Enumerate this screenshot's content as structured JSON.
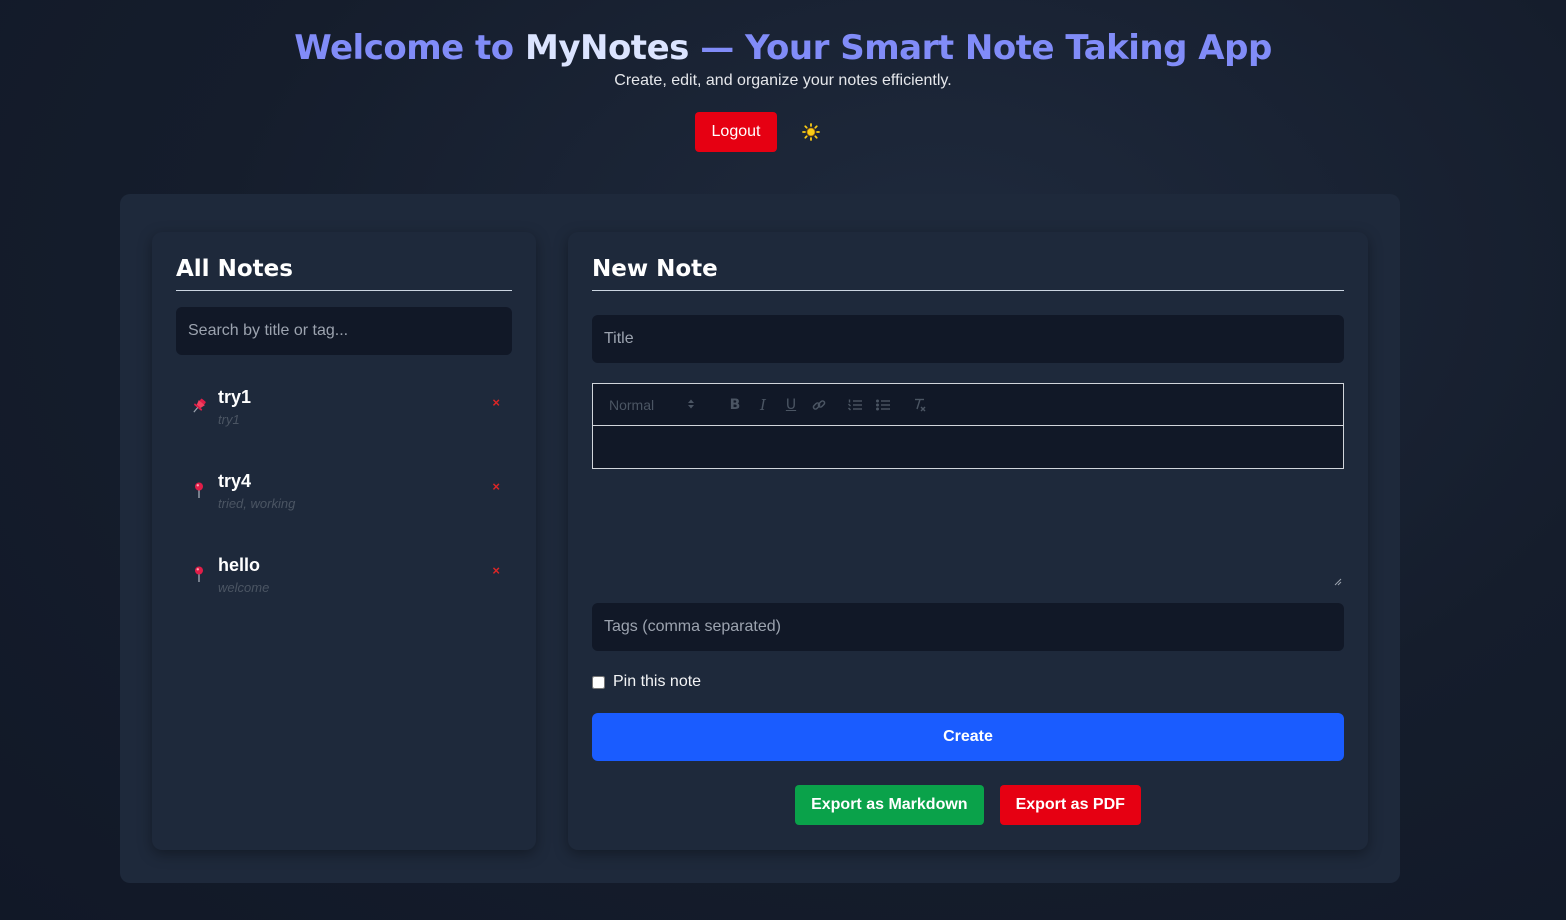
{
  "header": {
    "title_prefix": "Welcome to ",
    "title_brand": "MyNotes",
    "title_suffix": " — Your Smart Note Taking App",
    "subtitle": "Create, edit, and organize your notes efficiently.",
    "logout_label": "Logout",
    "theme_toggle_icon": "sun-icon"
  },
  "sidebar": {
    "heading": "All Notes",
    "search_placeholder": "Search by title or tag...",
    "notes": [
      {
        "title": "try1",
        "tags": "try1",
        "pinned": true,
        "icon": "pushpin-icon",
        "delete_label": "×"
      },
      {
        "title": "try4",
        "tags": "tried, working",
        "pinned": false,
        "icon": "round-pin-icon",
        "delete_label": "×"
      },
      {
        "title": "hello",
        "tags": "welcome",
        "pinned": false,
        "icon": "round-pin-icon",
        "delete_label": "×"
      }
    ]
  },
  "editor": {
    "heading": "New Note",
    "title_placeholder": "Title",
    "format_select": "Normal",
    "toolbar": {
      "bold": "B",
      "italic": "I",
      "underline": "U"
    },
    "tags_placeholder": "Tags (comma separated)",
    "pin_label": "Pin this note",
    "create_label": "Create",
    "export_markdown_label": "Export as Markdown",
    "export_pdf_label": "Export as PDF"
  },
  "colors": {
    "accent": "#818cf8",
    "danger": "#e60012",
    "primary": "#1a5cff",
    "success": "#0aa24a",
    "panel": "#1e293b",
    "input": "#111827"
  }
}
